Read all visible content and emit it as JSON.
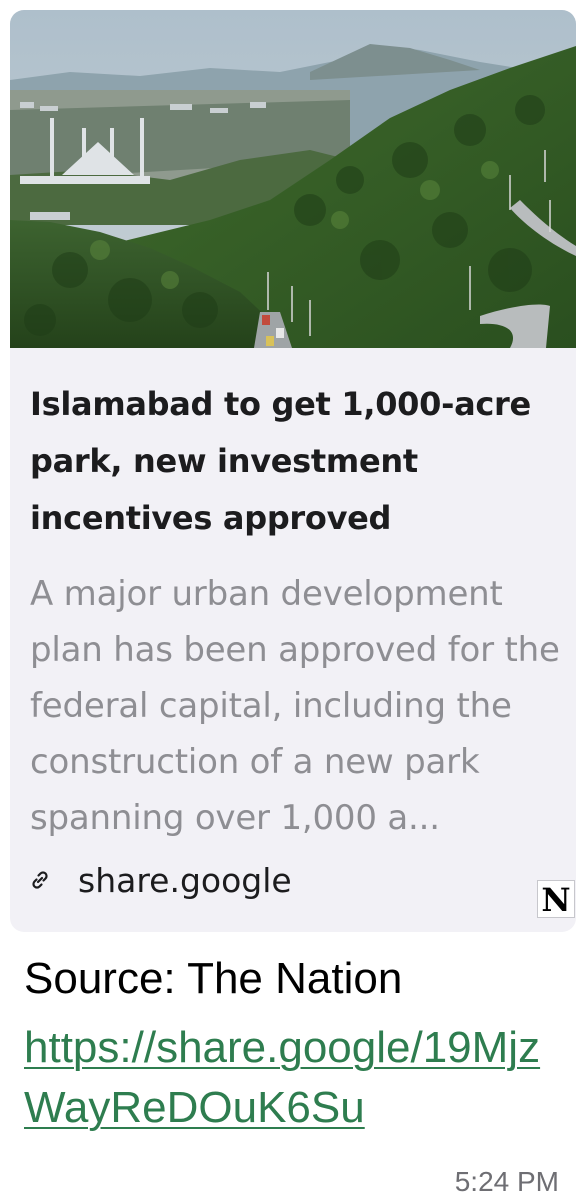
{
  "preview_card": {
    "image_alt": "Aerial view of Islamabad with Faisal Mosque and green Margalla hills",
    "title": "Islamabad to get 1,000-acre park, new investment incentives approved",
    "description": "A major urban development plan has been approved for the federal capital, including the construction of a new park spanning over 1,000 a...",
    "domain": "share.google",
    "link_icon": "link-icon",
    "publisher_logo_text": "N"
  },
  "message": {
    "source_text": "Source: The Nation",
    "url": "https://share.google/19MjzWayReDOuK6Su",
    "timestamp": "5:24 PM"
  },
  "colors": {
    "card_background": "#f2f1f6",
    "link_color": "#2e7d4f",
    "description_color": "#8e8e93"
  }
}
